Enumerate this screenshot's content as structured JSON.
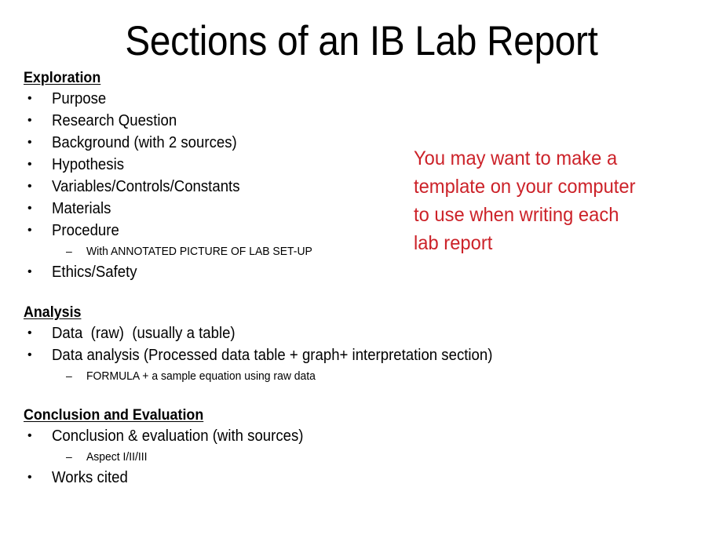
{
  "slide": {
    "title": "Sections of an IB Lab Report",
    "background_color": "#FFFFFF",
    "text_color": "#000000",
    "note_color": "#CC2229",
    "bullet_marker": "•",
    "subbullet_marker": "–"
  },
  "sections": [
    {
      "heading": "Exploration",
      "items": [
        {
          "level": 1,
          "text": "Purpose"
        },
        {
          "level": 1,
          "text": "Research Question"
        },
        {
          "level": 1,
          "text": "Background (with 2 sources)"
        },
        {
          "level": 1,
          "text": "Hypothesis"
        },
        {
          "level": 1,
          "text": "Variables/Controls/Constants"
        },
        {
          "level": 1,
          "text": "Materials"
        },
        {
          "level": 1,
          "text": "Procedure"
        },
        {
          "level": 2,
          "text": "With ANNOTATED PICTURE OF LAB SET-UP"
        },
        {
          "level": 1,
          "text": "Ethics/Safety"
        }
      ]
    },
    {
      "heading": "Analysis",
      "items": [
        {
          "level": 1,
          "text": "Data  (raw)  (usually a table)"
        },
        {
          "level": 1,
          "text": "Data analysis (Processed data table + graph+ interpretation section)"
        },
        {
          "level": 2,
          "text": "FORMULA + a sample equation using raw data"
        }
      ]
    },
    {
      "heading": "Conclusion and Evaluation",
      "items": [
        {
          "level": 1,
          "text": "Conclusion & evaluation (with sources)"
        },
        {
          "level": 2,
          "text": "Aspect I/II/III"
        },
        {
          "level": 1,
          "text": "Works cited"
        }
      ]
    }
  ],
  "note": {
    "lines": [
      "You may want to make a",
      "template on your computer",
      "to use when writing each",
      "lab report"
    ]
  }
}
